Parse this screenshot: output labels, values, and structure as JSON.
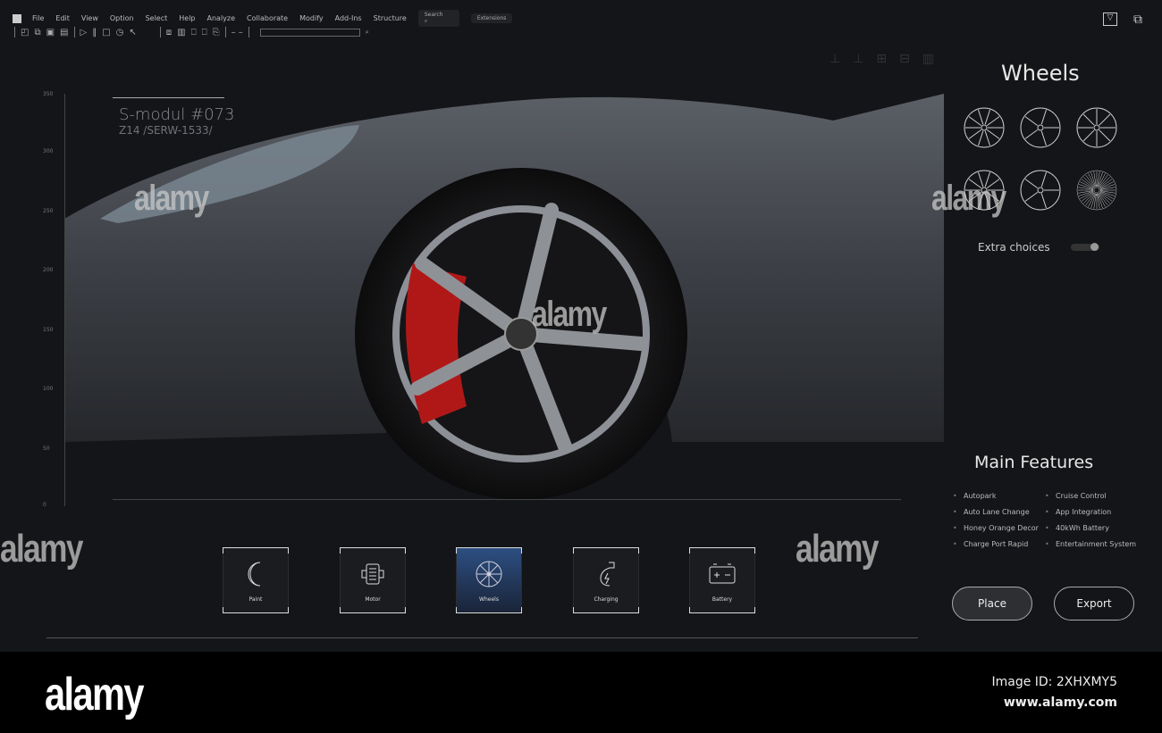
{
  "menu": {
    "items": [
      "File",
      "Edit",
      "View",
      "Option",
      "Select",
      "Help",
      "Analyze",
      "Collaborate",
      "Modify",
      "Add-Ins",
      "Structure"
    ],
    "search": "Search",
    "extensions": "Extensions"
  },
  "viewport": {
    "title": "S-modul #073",
    "subtitle": "Z14 /SERW-1533/",
    "ruler_ticks": [
      "350",
      "300",
      "250",
      "200",
      "150",
      "100",
      "50",
      "0"
    ]
  },
  "right": {
    "wheels_title": "Wheels",
    "extra_choices": "Extra choices",
    "extra_choices_on": true,
    "features_title": "Main Features",
    "features_left": [
      "Autopark",
      "Auto Lane Change",
      "Honey Orange Decor",
      "Charge Port Rapid"
    ],
    "features_right": [
      "Cruise Control",
      "App Integration",
      "40kWh Battery",
      "Entertainment System"
    ],
    "place": "Place",
    "export": "Export"
  },
  "categories": [
    {
      "label": "Paint",
      "icon": "paint-icon"
    },
    {
      "label": "Motor",
      "icon": "motor-icon"
    },
    {
      "label": "Wheels",
      "icon": "wheel-icon",
      "active": true
    },
    {
      "label": "Charging",
      "icon": "charging-icon"
    },
    {
      "label": "Battery",
      "icon": "battery-icon"
    }
  ],
  "footer": {
    "brand": "alamy",
    "image_id": "Image ID: 2XHXMY5",
    "url": "www.alamy.com"
  },
  "colors": {
    "background": "#141518",
    "active_card": "#2c4f82",
    "caliper": "#b01818"
  }
}
